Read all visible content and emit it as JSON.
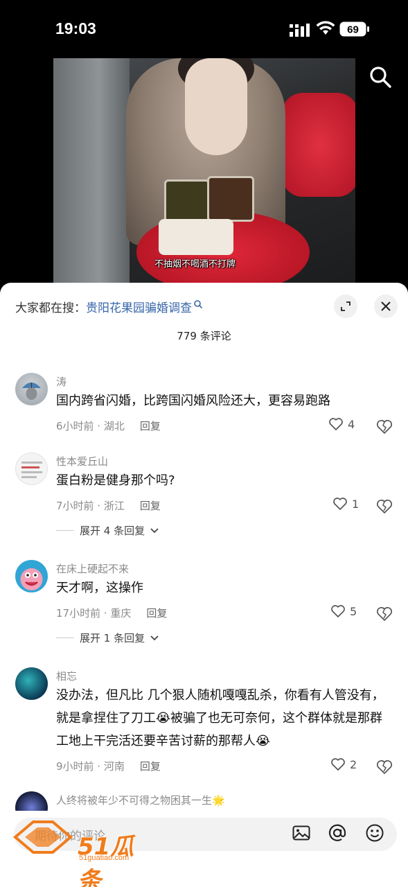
{
  "status_bar": {
    "time": "19:03",
    "battery": "69"
  },
  "video": {
    "subtitle": "不抽烟不喝酒不打牌"
  },
  "sheet": {
    "search_prefix": "大家都在搜：",
    "search_term": "贵阳花果园骗婚调查",
    "comment_count": "779 条评论"
  },
  "comments": [
    {
      "user": "涛",
      "text": "国内跨省闪婚，比跨国闪婚风险还大，更容易跑路",
      "time_loc": "6小时前 · 湖北",
      "reply": "回复",
      "likes": "4"
    },
    {
      "user": "性本爱丘山",
      "text": "蛋白粉是健身那个吗?",
      "time_loc": "7小时前 · 浙江",
      "reply": "回复",
      "likes": "1",
      "expand": "展开 4 条回复"
    },
    {
      "user": "在床上硬起不来",
      "text": "天才啊，这操作",
      "time_loc": "17小时前 · 重庆",
      "reply": "回复",
      "likes": "5",
      "expand": "展开 1 条回复"
    },
    {
      "user": "相忘",
      "text": "没办法，但凡比 几个狠人随机嘎嘎乱杀，你看有人管没有，就是拿捏住了刀工😭被骗了也无可奈何，这个群体就是那群工地上干完活还要辛苦讨薪的那帮人😭",
      "time_loc": "9小时前 · 河南",
      "reply": "回复",
      "likes": "2"
    },
    {
      "user": "人终将被年少不可得之物困其一生🌟"
    }
  ],
  "input": {
    "placeholder": "期待你的评论"
  },
  "watermark": {
    "brand": "51瓜条",
    "url": "51guatiao.com"
  },
  "icons": [
    "signal-icon",
    "wifi-icon",
    "battery-icon",
    "search-icon",
    "expand-icon",
    "close-icon",
    "heart-icon",
    "dislike-icon",
    "chevron-down-icon",
    "image-icon",
    "at-icon",
    "emoji-icon"
  ],
  "colors": {
    "link": "#3766a8",
    "watermark": "#f07c1c"
  }
}
